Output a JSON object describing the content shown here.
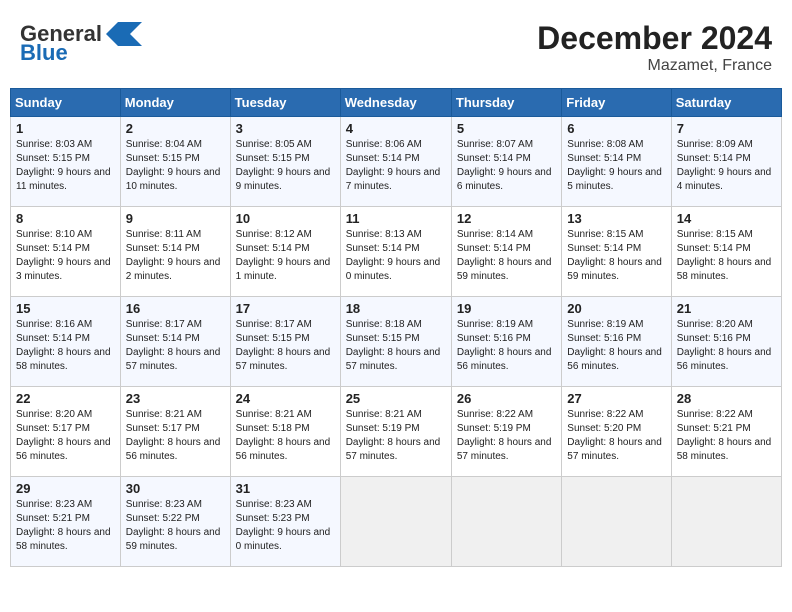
{
  "header": {
    "logo_general": "General",
    "logo_blue": "Blue",
    "title": "December 2024",
    "subtitle": "Mazamet, France"
  },
  "weekdays": [
    "Sunday",
    "Monday",
    "Tuesday",
    "Wednesday",
    "Thursday",
    "Friday",
    "Saturday"
  ],
  "weeks": [
    [
      {
        "day": "1",
        "info": "Sunrise: 8:03 AM\nSunset: 5:15 PM\nDaylight: 9 hours and 11 minutes."
      },
      {
        "day": "2",
        "info": "Sunrise: 8:04 AM\nSunset: 5:15 PM\nDaylight: 9 hours and 10 minutes."
      },
      {
        "day": "3",
        "info": "Sunrise: 8:05 AM\nSunset: 5:15 PM\nDaylight: 9 hours and 9 minutes."
      },
      {
        "day": "4",
        "info": "Sunrise: 8:06 AM\nSunset: 5:14 PM\nDaylight: 9 hours and 7 minutes."
      },
      {
        "day": "5",
        "info": "Sunrise: 8:07 AM\nSunset: 5:14 PM\nDaylight: 9 hours and 6 minutes."
      },
      {
        "day": "6",
        "info": "Sunrise: 8:08 AM\nSunset: 5:14 PM\nDaylight: 9 hours and 5 minutes."
      },
      {
        "day": "7",
        "info": "Sunrise: 8:09 AM\nSunset: 5:14 PM\nDaylight: 9 hours and 4 minutes."
      }
    ],
    [
      {
        "day": "8",
        "info": "Sunrise: 8:10 AM\nSunset: 5:14 PM\nDaylight: 9 hours and 3 minutes."
      },
      {
        "day": "9",
        "info": "Sunrise: 8:11 AM\nSunset: 5:14 PM\nDaylight: 9 hours and 2 minutes."
      },
      {
        "day": "10",
        "info": "Sunrise: 8:12 AM\nSunset: 5:14 PM\nDaylight: 9 hours and 1 minute."
      },
      {
        "day": "11",
        "info": "Sunrise: 8:13 AM\nSunset: 5:14 PM\nDaylight: 9 hours and 0 minutes."
      },
      {
        "day": "12",
        "info": "Sunrise: 8:14 AM\nSunset: 5:14 PM\nDaylight: 8 hours and 59 minutes."
      },
      {
        "day": "13",
        "info": "Sunrise: 8:15 AM\nSunset: 5:14 PM\nDaylight: 8 hours and 59 minutes."
      },
      {
        "day": "14",
        "info": "Sunrise: 8:15 AM\nSunset: 5:14 PM\nDaylight: 8 hours and 58 minutes."
      }
    ],
    [
      {
        "day": "15",
        "info": "Sunrise: 8:16 AM\nSunset: 5:14 PM\nDaylight: 8 hours and 58 minutes."
      },
      {
        "day": "16",
        "info": "Sunrise: 8:17 AM\nSunset: 5:14 PM\nDaylight: 8 hours and 57 minutes."
      },
      {
        "day": "17",
        "info": "Sunrise: 8:17 AM\nSunset: 5:15 PM\nDaylight: 8 hours and 57 minutes."
      },
      {
        "day": "18",
        "info": "Sunrise: 8:18 AM\nSunset: 5:15 PM\nDaylight: 8 hours and 57 minutes."
      },
      {
        "day": "19",
        "info": "Sunrise: 8:19 AM\nSunset: 5:16 PM\nDaylight: 8 hours and 56 minutes."
      },
      {
        "day": "20",
        "info": "Sunrise: 8:19 AM\nSunset: 5:16 PM\nDaylight: 8 hours and 56 minutes."
      },
      {
        "day": "21",
        "info": "Sunrise: 8:20 AM\nSunset: 5:16 PM\nDaylight: 8 hours and 56 minutes."
      }
    ],
    [
      {
        "day": "22",
        "info": "Sunrise: 8:20 AM\nSunset: 5:17 PM\nDaylight: 8 hours and 56 minutes."
      },
      {
        "day": "23",
        "info": "Sunrise: 8:21 AM\nSunset: 5:17 PM\nDaylight: 8 hours and 56 minutes."
      },
      {
        "day": "24",
        "info": "Sunrise: 8:21 AM\nSunset: 5:18 PM\nDaylight: 8 hours and 56 minutes."
      },
      {
        "day": "25",
        "info": "Sunrise: 8:21 AM\nSunset: 5:19 PM\nDaylight: 8 hours and 57 minutes."
      },
      {
        "day": "26",
        "info": "Sunrise: 8:22 AM\nSunset: 5:19 PM\nDaylight: 8 hours and 57 minutes."
      },
      {
        "day": "27",
        "info": "Sunrise: 8:22 AM\nSunset: 5:20 PM\nDaylight: 8 hours and 57 minutes."
      },
      {
        "day": "28",
        "info": "Sunrise: 8:22 AM\nSunset: 5:21 PM\nDaylight: 8 hours and 58 minutes."
      }
    ],
    [
      {
        "day": "29",
        "info": "Sunrise: 8:23 AM\nSunset: 5:21 PM\nDaylight: 8 hours and 58 minutes."
      },
      {
        "day": "30",
        "info": "Sunrise: 8:23 AM\nSunset: 5:22 PM\nDaylight: 8 hours and 59 minutes."
      },
      {
        "day": "31",
        "info": "Sunrise: 8:23 AM\nSunset: 5:23 PM\nDaylight: 9 hours and 0 minutes."
      },
      null,
      null,
      null,
      null
    ]
  ]
}
